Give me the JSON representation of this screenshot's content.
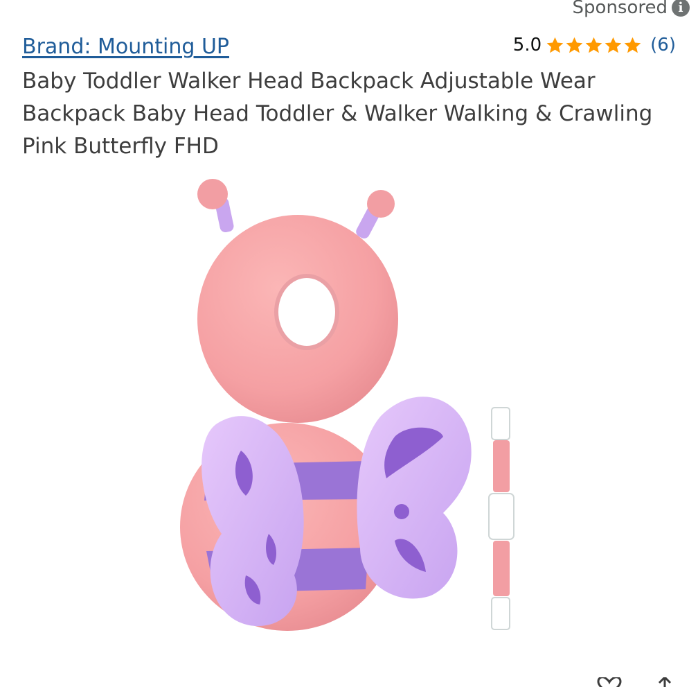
{
  "sponsored": {
    "label": "Sponsored",
    "info_icon": "info-icon"
  },
  "product": {
    "brand_link": "Brand: Mounting UP",
    "rating_value": "5.0",
    "stars": 5,
    "rating_count": "(6)",
    "title": "Baby Toddler Walker Head Backpack Adjustable Wear Backpack Baby Head Toddler & Walker Walking & Crawling Pink Butterfly FHD",
    "image_icon": "pink-butterfly-head-cushion-image"
  },
  "colors": {
    "link": "#1f5c99",
    "star": "#ff9900",
    "title": "#3d3d3d",
    "muted": "#565959"
  },
  "bottom_icons": [
    "heart-icon",
    "share-icon"
  ]
}
